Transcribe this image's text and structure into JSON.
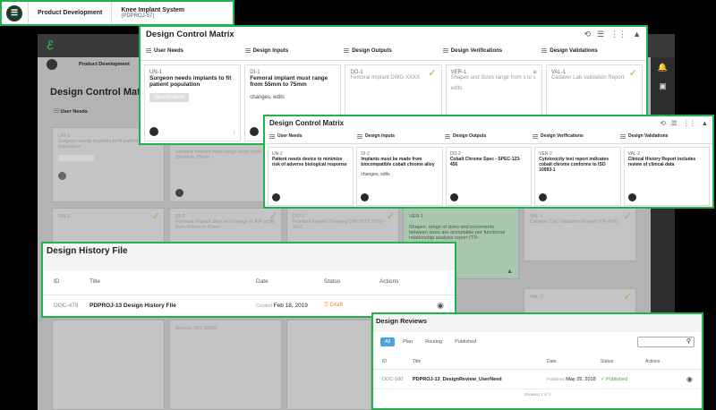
{
  "breadcrumb": {
    "project": "Product Development",
    "item": "Knee Implant System",
    "item_id": "(PDPROJ-57)"
  },
  "bg": {
    "crumb": "Product Development",
    "title": "Design Control Matrix",
    "col1": "User Needs",
    "cards": [
      {
        "id": "UN-1",
        "title": "Surgeon needs implants to fit patient population"
      },
      {
        "id": "DI-1",
        "title": "Femoral implant must range width from 55mm to 75mm"
      },
      {
        "id": "UN-1",
        "title": ""
      },
      {
        "id": "DI-2",
        "title": "Femoral implant alloy must range in A/P width from 40mm to 60mm"
      },
      {
        "id": "DO-2",
        "title": "Femoral Implant Drawing DW-0123 2020-XXX"
      },
      {
        "id": "VER-1",
        "title": "Shapes, range of sizes and increments between sizes are acceptable per functional relationship analysis report (TR-"
      },
      {
        "id": "VAL-1",
        "title": "Cadaver Lab Validation Report (TR-456)"
      },
      {
        "id": "VAL-2",
        "title": ""
      }
    ],
    "source": "Source: ISO 10993"
  },
  "dcm1": {
    "title": "Design Control Matrix",
    "cols": [
      "User Needs",
      "Design Inputs",
      "Design Outputs",
      "Design Verifications",
      "Design Validations"
    ],
    "cards": [
      {
        "id": "UN-1",
        "title": "Surgeon needs implants to fit patient population",
        "tag": "Specification"
      },
      {
        "id": "DI-1",
        "title": "Femoral implant must range from 55mm to 75mm",
        "note": "changes, edits"
      },
      {
        "id": "DO-1",
        "title": "Femoral Implant DWG-XXXX"
      },
      {
        "id": "VER-1",
        "title": "Shapes and Sizes range from s to s",
        "note": "edits"
      },
      {
        "id": "VAL-1",
        "title": "Cadaver Lab Validation Report"
      }
    ]
  },
  "dcm2": {
    "title": "Design Control Matrix",
    "cols": [
      "User Needs",
      "Design Inputs",
      "Design Outputs",
      "Design Verifications",
      "Design Validations"
    ],
    "cards": [
      {
        "id": "UN-2",
        "title": "Patient needs device to minimize risk of adverse biological response"
      },
      {
        "id": "DI-2",
        "title": "Implants must be made from biocompatible cobalt chrome alloy",
        "note": "changes, edits"
      },
      {
        "id": "DO-2",
        "title": "Cobalt Chrome Spec - SPEC-123-456"
      },
      {
        "id": "VER-2",
        "title": "Cytotoxicity test report indicates cobalt chrome conforms to ISO 10993-1"
      },
      {
        "id": "VAL-2",
        "title": "Clinical History Report includes review of clinical data"
      }
    ]
  },
  "dhf": {
    "title": "Design History File",
    "headers": {
      "id": "ID",
      "title": "Title",
      "date": "Date",
      "status": "Status",
      "actions": "Actions"
    },
    "row": {
      "id": "DOC-478",
      "title": "PDPROJ-13 Design History File",
      "date_label": "Created",
      "date": "Feb 18, 2019",
      "status": "Draft"
    }
  },
  "dr": {
    "title": "Design Reviews",
    "tabs": [
      "All",
      "Plan",
      "Routing",
      "Published"
    ],
    "headers": {
      "id": "ID",
      "title": "Title",
      "date": "Date",
      "status": "Status",
      "actions": "Actions"
    },
    "row": {
      "id": "DOC-160",
      "title": "PDPROJ-13_DesignReview_UserNeed",
      "date_label": "Published",
      "date": "May 25, 2018",
      "status": "Published"
    },
    "footer": "Showing 1 of 1"
  }
}
